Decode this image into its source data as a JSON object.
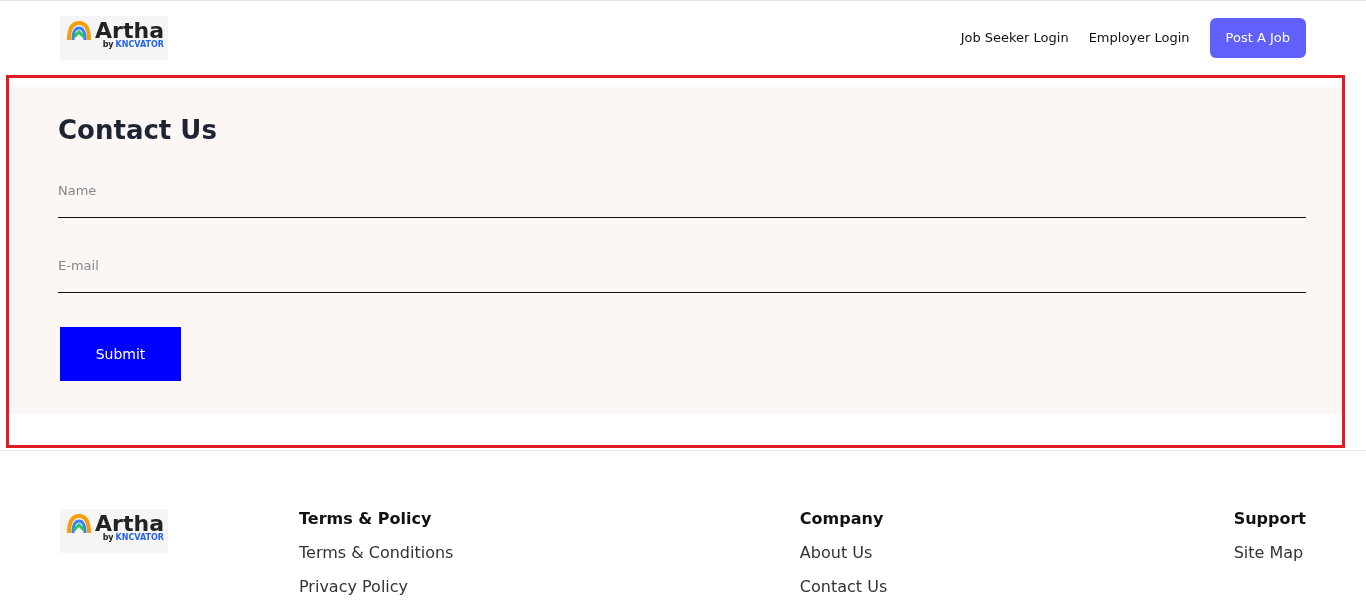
{
  "header": {
    "logo": {
      "name": "Artha",
      "byline": "by",
      "brand": "KNCVATOR"
    },
    "nav": [
      {
        "label": "Job Seeker Login",
        "kind": "link"
      },
      {
        "label": "Employer Login",
        "kind": "link"
      },
      {
        "label": "Post A Job",
        "kind": "button"
      }
    ]
  },
  "contact": {
    "title": "Contact Us",
    "fields": [
      {
        "placeholder": "Name"
      },
      {
        "placeholder": "E-mail"
      }
    ],
    "submit": "Submit"
  },
  "footer": {
    "logo": {
      "name": "Artha",
      "byline": "by",
      "brand": "KNCVATOR"
    },
    "columns": [
      {
        "heading": "Terms & Policy",
        "links": [
          "Terms & Conditions",
          "Privacy Policy"
        ]
      },
      {
        "heading": "Company",
        "links": [
          "About Us",
          "Contact Us"
        ]
      },
      {
        "heading": "Support",
        "links": [
          "Site Map"
        ]
      }
    ]
  }
}
